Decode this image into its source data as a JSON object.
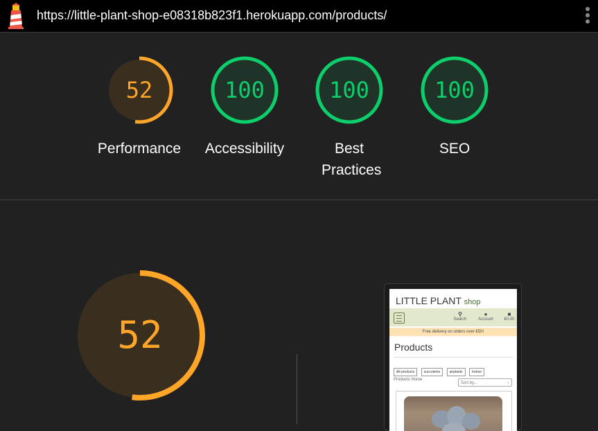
{
  "header": {
    "url": "https://little-plant-shop-e08318b823f1.herokuapp.com/products/"
  },
  "colors": {
    "average": "#ffa629",
    "pass": "#0cce6b",
    "background": "#212121"
  },
  "scores": [
    {
      "value": "52",
      "label": "Performance",
      "fraction": 0.52,
      "status": "average"
    },
    {
      "value": "100",
      "label": "Accessibility",
      "fraction": 1.0,
      "status": "pass"
    },
    {
      "value": "100",
      "label": "Best Practices",
      "fraction": 1.0,
      "status": "pass"
    },
    {
      "value": "100",
      "label": "SEO",
      "fraction": 1.0,
      "status": "pass"
    }
  ],
  "performance": {
    "value": "52",
    "fraction": 0.52
  },
  "preview": {
    "brand": "LITTLE PLANT",
    "brand_suffix": "shop",
    "nav": {
      "search": "Search",
      "account": "Account",
      "bag": "€0.00"
    },
    "banner": "Free delivery on orders over €50!",
    "title": "Products",
    "chips": [
      "All products",
      "succulents",
      "airplants",
      "Indoor"
    ],
    "breadcrumb": "Products Home",
    "sort_placeholder": "Sort by..."
  },
  "icons": [
    "lighthouse-icon",
    "kebab-menu-icon",
    "hamburger-icon",
    "search-icon",
    "account-icon",
    "bag-icon"
  ]
}
